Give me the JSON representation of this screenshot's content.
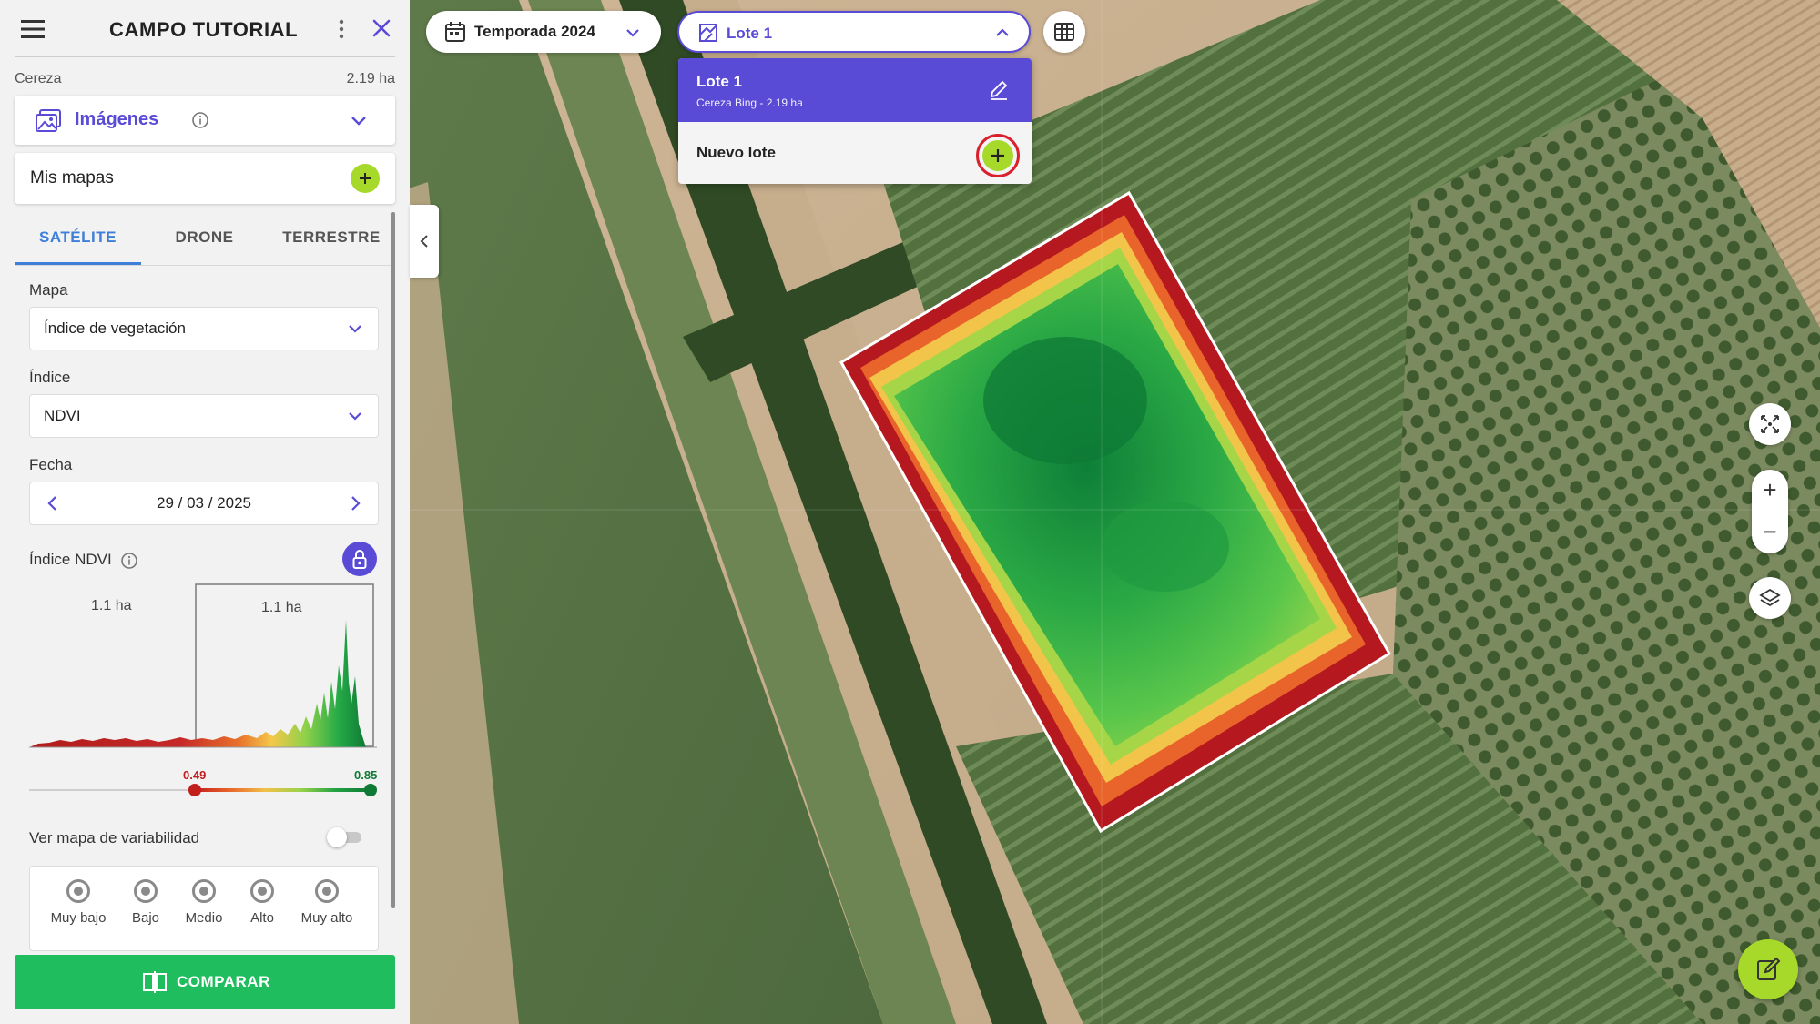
{
  "sidebar": {
    "title": "CAMPO TUTORIAL",
    "crop": "Cereza",
    "area": "2.19 ha",
    "images_label": "Imágenes",
    "my_maps_label": "Mis mapas",
    "tabs": [
      "SATÉLITE",
      "DRONE",
      "TERRESTRE"
    ],
    "active_tab": "SATÉLITE",
    "map_label": "Mapa",
    "map_value": "Índice de vegetación",
    "index_label": "Índice",
    "index_value": "NDVI",
    "date_label": "Fecha",
    "date_value": "29 / 03 / 2025",
    "ndvi_label": "Índice NDVI",
    "histogram": {
      "left_area": "1.1 ha",
      "right_area": "1.1 ha",
      "min_threshold": "0.49",
      "max_threshold": "0.85"
    },
    "variability_label": "Ver mapa de variabilidad",
    "variability_on": false,
    "levels": [
      "Muy bajo",
      "Bajo",
      "Medio",
      "Alto",
      "Muy alto"
    ],
    "compare_label": "COMPARAR"
  },
  "toolbar": {
    "season": "Temporada 2024",
    "lote": "Lote 1"
  },
  "lote_dropdown": {
    "selected_name": "Lote 1",
    "selected_sub": "Cereza Bing - 2.19 ha",
    "new_label": "Nuevo lote"
  },
  "map_controls": {
    "zoom_in": "+",
    "zoom_out": "−"
  },
  "colors": {
    "accent": "#5a4bd6",
    "tab_active": "#3e7fd9",
    "compare": "#1fbd5d",
    "lime": "#a7d92a",
    "ndvi_low": "#c21e1e",
    "ndvi_high": "#0f7a35"
  }
}
